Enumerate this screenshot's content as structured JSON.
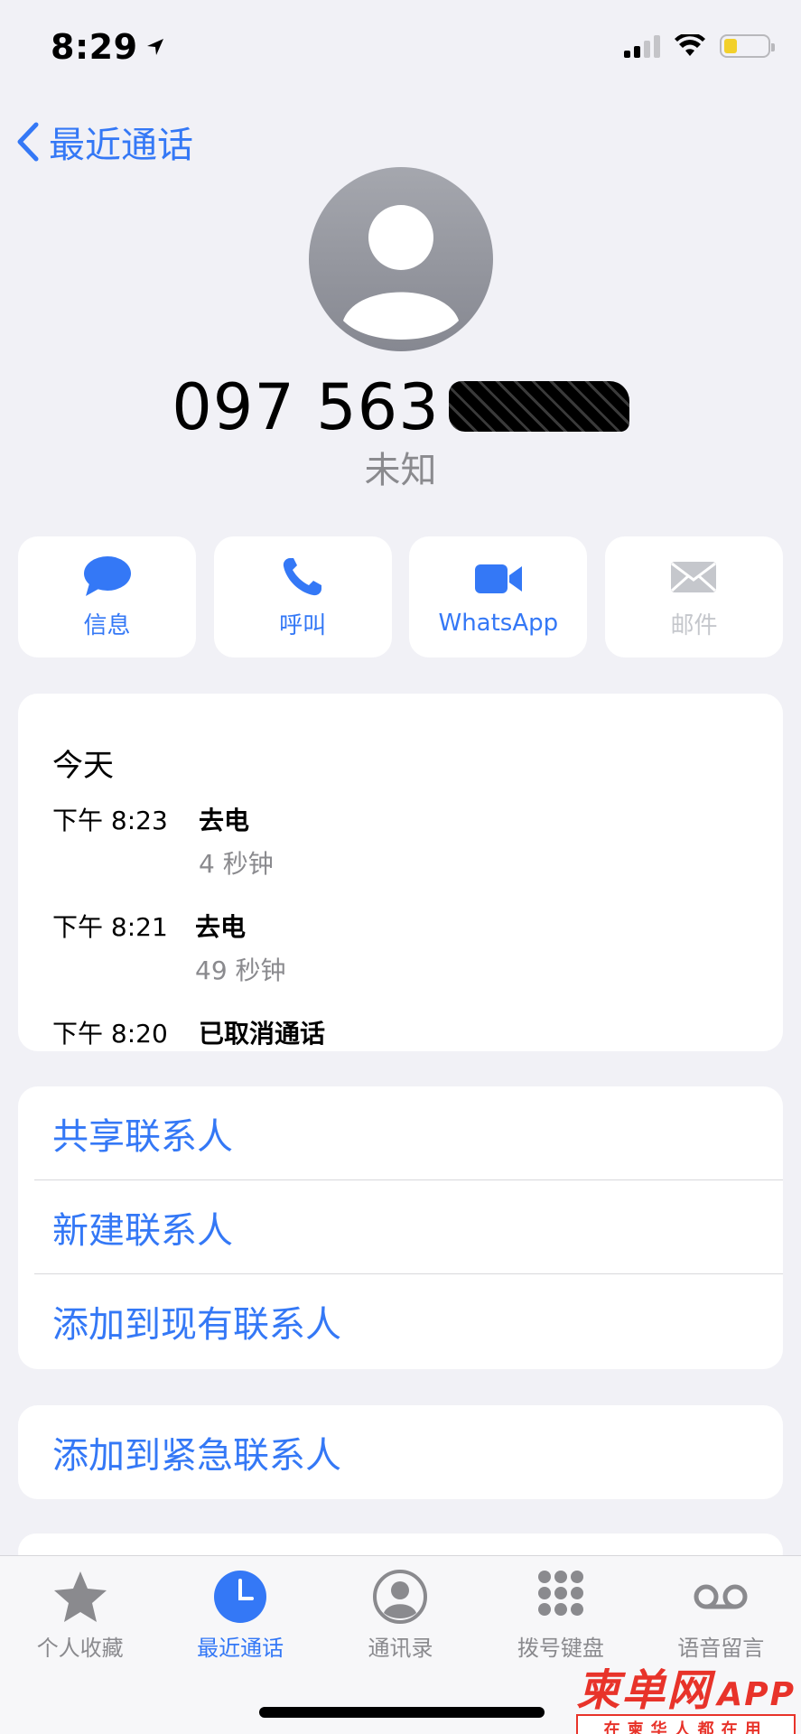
{
  "status": {
    "time": "8:29",
    "battery_color": "#f2d02b"
  },
  "nav": {
    "back_label": "最近通话"
  },
  "contact": {
    "number_visible": "097 563",
    "label": "未知"
  },
  "actions": [
    {
      "label": "信息",
      "icon": "message-icon",
      "enabled": true
    },
    {
      "label": "呼叫",
      "icon": "phone-icon",
      "enabled": true
    },
    {
      "label": "WhatsApp",
      "icon": "video-icon",
      "enabled": true
    },
    {
      "label": "邮件",
      "icon": "mail-icon",
      "enabled": false
    }
  ],
  "history": {
    "day": "今天",
    "entries": [
      {
        "time": "下午 8:23",
        "type": "去电",
        "duration": "4 秒钟"
      },
      {
        "time": "下午 8:21",
        "type": "去电",
        "duration": "49 秒钟"
      },
      {
        "time": "下午 8:20",
        "type": "已取消通话",
        "duration": ""
      }
    ]
  },
  "links": [
    "共享联系人",
    "新建联系人",
    "添加到现有联系人"
  ],
  "emergency": "添加到紧急联系人",
  "tabs": [
    {
      "label": "个人收藏",
      "icon": "star-icon",
      "active": false
    },
    {
      "label": "最近通话",
      "icon": "clock-icon",
      "active": true
    },
    {
      "label": "通讯录",
      "icon": "contacts-icon",
      "active": false
    },
    {
      "label": "拨号键盘",
      "icon": "keypad-icon",
      "active": false
    },
    {
      "label": "语音留言",
      "icon": "voicemail-icon",
      "active": false
    }
  ],
  "watermark": {
    "logo": "柬单网",
    "app": "APP",
    "sub": "在柬华人都在用"
  },
  "colors": {
    "accent": "#3478f6",
    "background": "#f1f1f6",
    "secondary": "#8a8a8e"
  }
}
